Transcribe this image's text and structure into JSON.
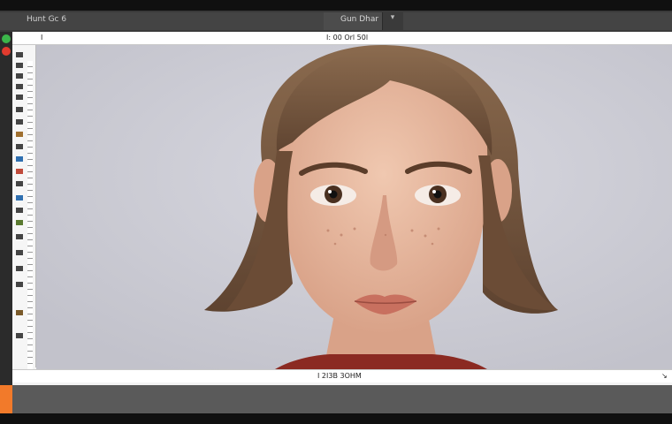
{
  "tabstrip": {
    "left_label": "Hunt Gc 6",
    "center_label": "Gun Dhar",
    "caret": "▾"
  },
  "options_bar": {
    "left_glyph": "I",
    "center_text": "I: 00 Orl 50l"
  },
  "status_bar": {
    "center_text": "I 2I3B 3OHM",
    "right_glyph": "↘"
  },
  "colors": {
    "accent": "#f27a2a",
    "dot_green": "#3bb54a",
    "dot_red": "#e23b2e",
    "canvas_bg": "#cfcfd6"
  },
  "icons": {
    "left_dots": [
      "green-circle-icon",
      "red-circle-icon"
    ],
    "timeline": "timeline-handle-icon"
  }
}
